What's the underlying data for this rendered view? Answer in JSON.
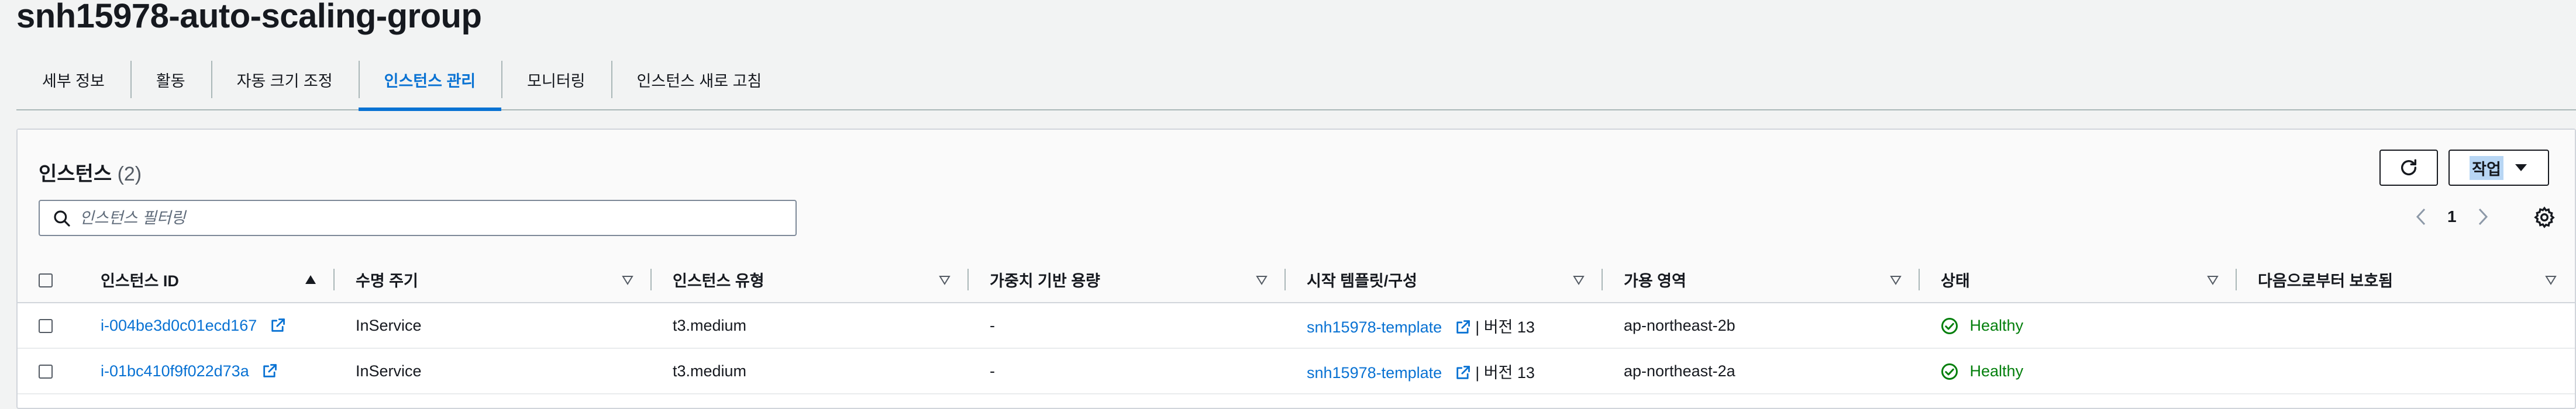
{
  "page": {
    "title": "snh15978-auto-scaling-group"
  },
  "tabs": [
    {
      "label": "세부 정보"
    },
    {
      "label": "활동"
    },
    {
      "label": "자동 크기 조정"
    },
    {
      "label": "인스턴스 관리",
      "active": true
    },
    {
      "label": "모니터링"
    },
    {
      "label": "인스턴스 새로 고침"
    }
  ],
  "instances": {
    "title": "인스턴스",
    "count": "(2)",
    "actions_label": "작업",
    "filter_placeholder": "인스턴스 필터링",
    "page_number": "1",
    "columns": [
      "인스턴스 ID",
      "수명 주기",
      "인스턴스 유형",
      "가중치 기반 용량",
      "시작 템플릿/구성",
      "가용 영역",
      "상태",
      "다음으로부터 보호됨"
    ],
    "rows": [
      {
        "id": "i-004be3d0c01ecd167",
        "lifecycle": "InService",
        "type": "t3.medium",
        "weight": "-",
        "template": "snh15978-template",
        "version": "| 버전 13",
        "az": "ap-northeast-2b",
        "health": "Healthy",
        "protected": ""
      },
      {
        "id": "i-01bc410f9f022d73a",
        "lifecycle": "InService",
        "type": "t3.medium",
        "weight": "-",
        "template": "snh15978-template",
        "version": "| 버전 13",
        "az": "ap-northeast-2a",
        "health": "Healthy",
        "protected": ""
      }
    ]
  },
  "colors": {
    "accent": "#0972d3",
    "healthy": "#037f0c"
  },
  "icons": [
    "search-icon",
    "refresh-icon",
    "caret-down-icon",
    "chevron-left-icon",
    "chevron-right-icon",
    "gear-icon",
    "sort-asc-icon",
    "sort-desc-icon",
    "external-link-icon",
    "check-circle-icon"
  ]
}
